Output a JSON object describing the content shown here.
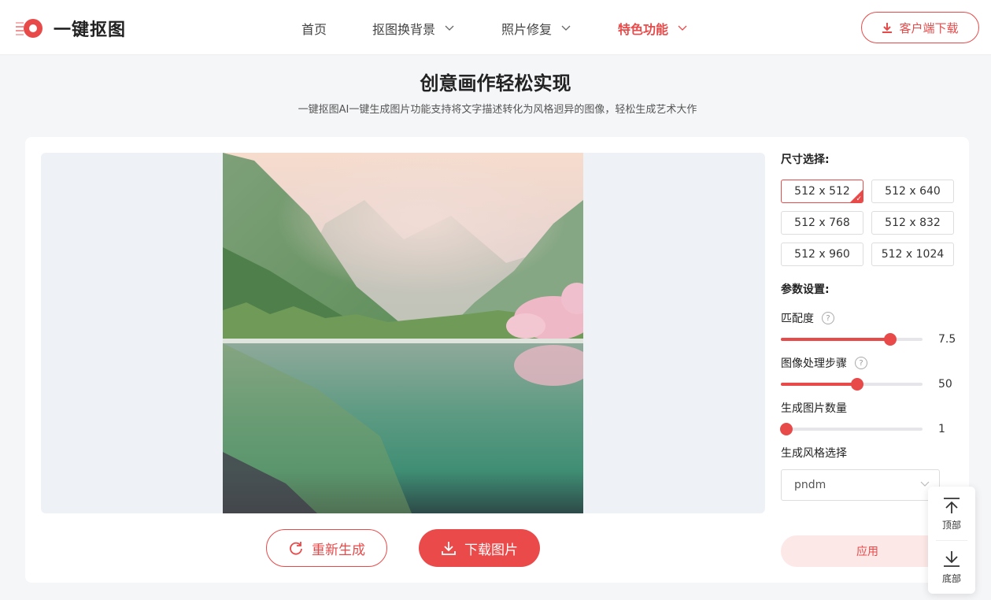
{
  "app": {
    "logo_text": "一键抠图",
    "accent": "#e84a4a"
  },
  "nav": {
    "items": [
      {
        "label": "首页",
        "has_dropdown": false,
        "active": false
      },
      {
        "label": "抠图换背景",
        "has_dropdown": true,
        "active": false
      },
      {
        "label": "照片修复",
        "has_dropdown": true,
        "active": false
      },
      {
        "label": "特色功能",
        "has_dropdown": true,
        "active": true
      }
    ],
    "download_label": "客户端下载"
  },
  "hero": {
    "title": "创意画作轻松实现",
    "subtitle": "一键抠图AI一键生成图片功能支持将文字描述转化为风格迥异的图像，轻松生成艺术大作"
  },
  "preview": {
    "image_alt": "lake-mountain-landscape",
    "regen_label": "重新生成",
    "download_label": "下载图片"
  },
  "panel": {
    "size_label": "尺寸选择:",
    "sizes": [
      "512 x 512",
      "512 x 640",
      "512 x 768",
      "512 x 832",
      "512 x 960",
      "512 x 1024"
    ],
    "selected_size": "512 x 512",
    "params_label": "参数设置:",
    "params": [
      {
        "label": "匹配度",
        "help": true,
        "value": "7.5",
        "fraction": 0.77
      },
      {
        "label": "图像处理步骤",
        "help": true,
        "value": "50",
        "fraction": 0.54
      },
      {
        "label": "生成图片数量",
        "help": false,
        "value": "1",
        "fraction": 0.04
      }
    ],
    "style_label": "生成风格选择",
    "style_value": "pndm",
    "apply_label": "应用"
  },
  "float_bar": {
    "top_label": "顶部",
    "bottom_label": "底部"
  }
}
